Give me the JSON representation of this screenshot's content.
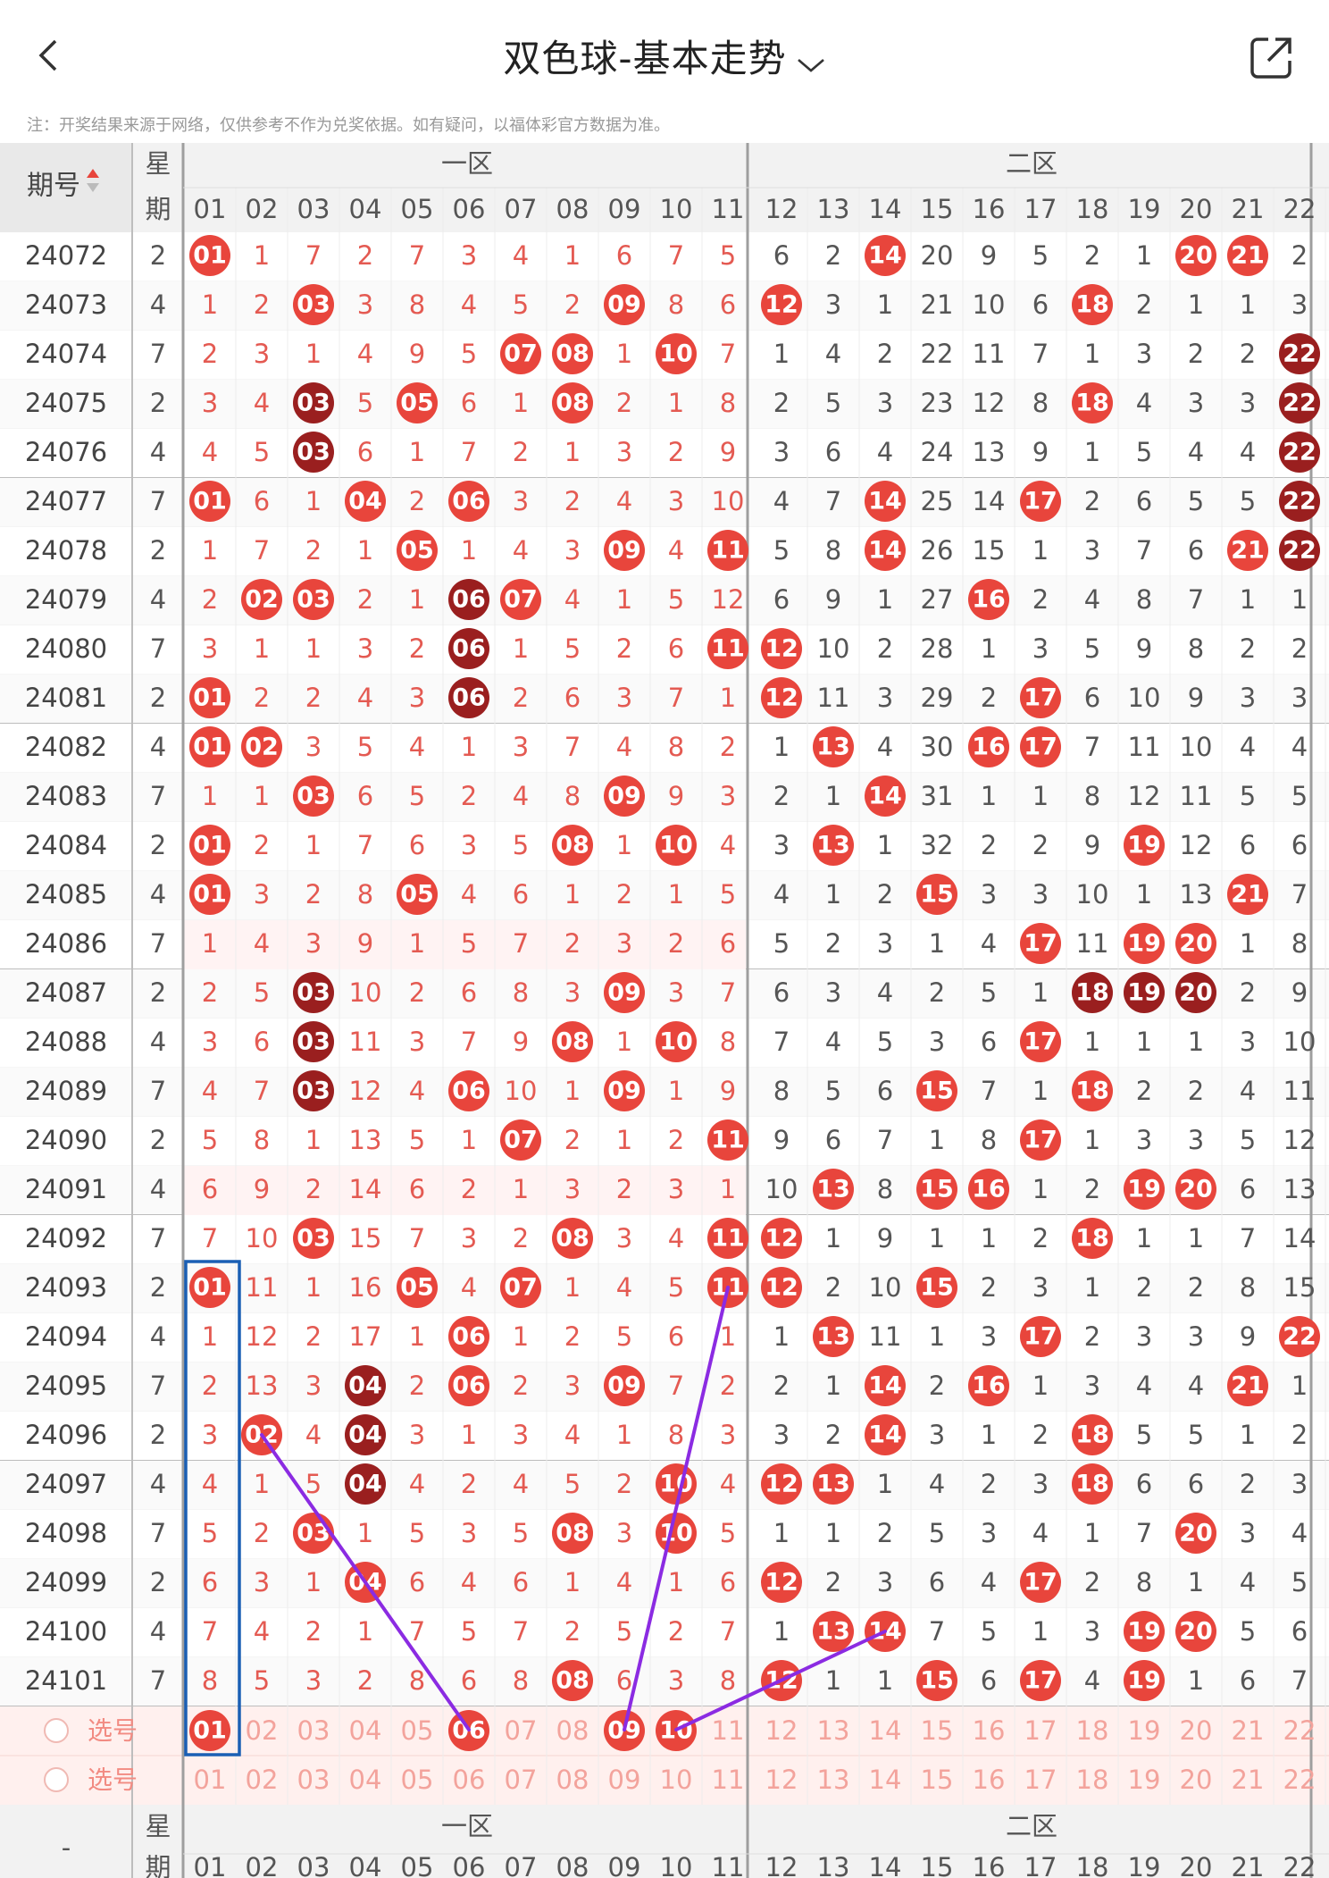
{
  "header": {
    "title": "双色球-基本走势",
    "note": "注：开奖结果来源于网络，仅供参考不作为兑奖依据。如有疑问，以福体彩官方数据为准。"
  },
  "columns": {
    "period_label": "期号",
    "week_label_1": "星",
    "week_label_2": "期",
    "zone1": "一区",
    "zone2": "二区",
    "numbers": [
      "01",
      "02",
      "03",
      "04",
      "05",
      "06",
      "07",
      "08",
      "09",
      "10",
      "11",
      "12",
      "13",
      "14",
      "15",
      "16",
      "17",
      "18",
      "19",
      "20",
      "21",
      "22"
    ]
  },
  "rows": [
    {
      "period": "24072",
      "week": "2",
      "cells": [
        "01",
        "1",
        "7",
        "2",
        "7",
        "3",
        "4",
        "1",
        "6",
        "7",
        "5",
        "6",
        "2",
        "14",
        "20",
        "9",
        "5",
        "2",
        "1",
        "20",
        "21",
        "2"
      ]
    },
    {
      "period": "24073",
      "week": "4",
      "cells": [
        "1",
        "2",
        "03",
        "3",
        "8",
        "4",
        "5",
        "2",
        "09",
        "8",
        "6",
        "12",
        "3",
        "1",
        "21",
        "10",
        "6",
        "18",
        "2",
        "1",
        "1",
        "3"
      ]
    },
    {
      "period": "24074",
      "week": "7",
      "cells": [
        "2",
        "3",
        "1",
        "4",
        "9",
        "5",
        "07",
        "08",
        "1",
        "10",
        "7",
        "1",
        "4",
        "2",
        "22",
        "11",
        "7",
        "1",
        "3",
        "2",
        "2",
        "22"
      ]
    },
    {
      "period": "24075",
      "week": "2",
      "cells": [
        "3",
        "4",
        "03",
        "5",
        "05",
        "6",
        "1",
        "08",
        "2",
        "1",
        "8",
        "2",
        "5",
        "3",
        "23",
        "12",
        "8",
        "18",
        "4",
        "3",
        "3",
        "22"
      ]
    },
    {
      "period": "24076",
      "week": "4",
      "cells": [
        "4",
        "5",
        "03",
        "6",
        "1",
        "7",
        "2",
        "1",
        "3",
        "2",
        "9",
        "3",
        "6",
        "4",
        "24",
        "13",
        "9",
        "1",
        "5",
        "4",
        "4",
        "22"
      ]
    },
    {
      "period": "24077",
      "week": "7",
      "cells": [
        "01",
        "6",
        "1",
        "04",
        "2",
        "06",
        "3",
        "2",
        "4",
        "3",
        "10",
        "4",
        "7",
        "14",
        "25",
        "14",
        "17",
        "2",
        "6",
        "5",
        "5",
        "22"
      ]
    },
    {
      "period": "24078",
      "week": "2",
      "cells": [
        "1",
        "7",
        "2",
        "1",
        "05",
        "1",
        "4",
        "3",
        "09",
        "4",
        "11",
        "5",
        "8",
        "14",
        "26",
        "15",
        "1",
        "3",
        "7",
        "6",
        "21",
        "22"
      ]
    },
    {
      "period": "24079",
      "week": "4",
      "cells": [
        "2",
        "02",
        "03",
        "2",
        "1",
        "06",
        "07",
        "4",
        "1",
        "5",
        "12",
        "6",
        "9",
        "1",
        "27",
        "16",
        "2",
        "4",
        "8",
        "7",
        "1",
        "1"
      ]
    },
    {
      "period": "24080",
      "week": "7",
      "cells": [
        "3",
        "1",
        "1",
        "3",
        "2",
        "06",
        "1",
        "5",
        "2",
        "6",
        "11",
        "12",
        "10",
        "2",
        "28",
        "1",
        "3",
        "5",
        "9",
        "8",
        "2",
        "2"
      ]
    },
    {
      "period": "24081",
      "week": "2",
      "cells": [
        "01",
        "2",
        "2",
        "4",
        "3",
        "06",
        "2",
        "6",
        "3",
        "7",
        "1",
        "12",
        "11",
        "3",
        "29",
        "2",
        "17",
        "6",
        "10",
        "9",
        "3",
        "3"
      ]
    },
    {
      "period": "24082",
      "week": "4",
      "cells": [
        "01",
        "02",
        "3",
        "5",
        "4",
        "1",
        "3",
        "7",
        "4",
        "8",
        "2",
        "1",
        "13",
        "4",
        "30",
        "16",
        "17",
        "7",
        "11",
        "10",
        "4",
        "4"
      ]
    },
    {
      "period": "24083",
      "week": "7",
      "cells": [
        "1",
        "1",
        "03",
        "6",
        "5",
        "2",
        "4",
        "8",
        "09",
        "9",
        "3",
        "2",
        "1",
        "14",
        "31",
        "1",
        "1",
        "8",
        "12",
        "11",
        "5",
        "5"
      ]
    },
    {
      "period": "24084",
      "week": "2",
      "cells": [
        "01",
        "2",
        "1",
        "7",
        "6",
        "3",
        "5",
        "08",
        "1",
        "10",
        "4",
        "3",
        "13",
        "1",
        "32",
        "2",
        "2",
        "9",
        "19",
        "12",
        "6",
        "6"
      ]
    },
    {
      "period": "24085",
      "week": "4",
      "cells": [
        "01",
        "3",
        "2",
        "8",
        "05",
        "4",
        "6",
        "1",
        "2",
        "1",
        "5",
        "4",
        "1",
        "2",
        "15",
        "3",
        "3",
        "10",
        "1",
        "13",
        "21",
        "7"
      ]
    },
    {
      "period": "24086",
      "week": "7",
      "cells": [
        "1",
        "4",
        "3",
        "9",
        "1",
        "5",
        "7",
        "2",
        "3",
        "2",
        "6",
        "5",
        "2",
        "3",
        "1",
        "4",
        "17",
        "11",
        "19",
        "20",
        "1",
        "8"
      ]
    },
    {
      "period": "24087",
      "week": "2",
      "cells": [
        "2",
        "5",
        "03",
        "10",
        "2",
        "6",
        "8",
        "3",
        "09",
        "3",
        "7",
        "6",
        "3",
        "4",
        "2",
        "5",
        "1",
        "18",
        "19",
        "20",
        "2",
        "9"
      ]
    },
    {
      "period": "24088",
      "week": "4",
      "cells": [
        "3",
        "6",
        "03",
        "11",
        "3",
        "7",
        "9",
        "08",
        "1",
        "10",
        "8",
        "7",
        "4",
        "5",
        "3",
        "6",
        "17",
        "1",
        "1",
        "1",
        "3",
        "10"
      ]
    },
    {
      "period": "24089",
      "week": "7",
      "cells": [
        "4",
        "7",
        "03",
        "12",
        "4",
        "06",
        "10",
        "1",
        "09",
        "1",
        "9",
        "8",
        "5",
        "6",
        "15",
        "7",
        "1",
        "18",
        "2",
        "2",
        "4",
        "11"
      ]
    },
    {
      "period": "24090",
      "week": "2",
      "cells": [
        "5",
        "8",
        "1",
        "13",
        "5",
        "1",
        "07",
        "2",
        "1",
        "2",
        "11",
        "9",
        "6",
        "7",
        "1",
        "8",
        "17",
        "1",
        "3",
        "3",
        "5",
        "12"
      ]
    },
    {
      "period": "24091",
      "week": "4",
      "cells": [
        "6",
        "9",
        "2",
        "14",
        "6",
        "2",
        "1",
        "3",
        "2",
        "3",
        "1",
        "10",
        "13",
        "8",
        "15",
        "16",
        "1",
        "2",
        "19",
        "20",
        "6",
        "13"
      ]
    },
    {
      "period": "24092",
      "week": "7",
      "cells": [
        "7",
        "10",
        "03",
        "15",
        "7",
        "3",
        "2",
        "08",
        "3",
        "4",
        "11",
        "12",
        "1",
        "9",
        "1",
        "1",
        "2",
        "18",
        "1",
        "1",
        "7",
        "14"
      ]
    },
    {
      "period": "24093",
      "week": "2",
      "cells": [
        "01",
        "11",
        "1",
        "16",
        "05",
        "4",
        "07",
        "1",
        "4",
        "5",
        "11",
        "12",
        "2",
        "10",
        "15",
        "2",
        "3",
        "1",
        "2",
        "2",
        "8",
        "15"
      ]
    },
    {
      "period": "24094",
      "week": "4",
      "cells": [
        "1",
        "12",
        "2",
        "17",
        "1",
        "06",
        "1",
        "2",
        "5",
        "6",
        "1",
        "1",
        "13",
        "11",
        "1",
        "3",
        "17",
        "2",
        "3",
        "3",
        "9",
        "22"
      ]
    },
    {
      "period": "24095",
      "week": "7",
      "cells": [
        "2",
        "13",
        "3",
        "04",
        "2",
        "06",
        "2",
        "3",
        "09",
        "7",
        "2",
        "2",
        "1",
        "14",
        "2",
        "16",
        "1",
        "3",
        "4",
        "4",
        "21",
        "1"
      ]
    },
    {
      "period": "24096",
      "week": "2",
      "cells": [
        "3",
        "02",
        "4",
        "04",
        "3",
        "1",
        "3",
        "4",
        "1",
        "8",
        "3",
        "3",
        "2",
        "14",
        "3",
        "1",
        "2",
        "18",
        "5",
        "5",
        "1",
        "2"
      ]
    },
    {
      "period": "24097",
      "week": "4",
      "cells": [
        "4",
        "1",
        "5",
        "04",
        "4",
        "2",
        "4",
        "5",
        "2",
        "10",
        "4",
        "12",
        "13",
        "1",
        "4",
        "2",
        "3",
        "18",
        "6",
        "6",
        "2",
        "3"
      ]
    },
    {
      "period": "24098",
      "week": "7",
      "cells": [
        "5",
        "2",
        "03",
        "1",
        "5",
        "3",
        "5",
        "08",
        "3",
        "10",
        "5",
        "1",
        "1",
        "2",
        "5",
        "3",
        "4",
        "1",
        "7",
        "20",
        "3",
        "4"
      ]
    },
    {
      "period": "24099",
      "week": "2",
      "cells": [
        "6",
        "3",
        "1",
        "04",
        "6",
        "4",
        "6",
        "1",
        "4",
        "1",
        "6",
        "12",
        "2",
        "3",
        "6",
        "4",
        "17",
        "2",
        "8",
        "1",
        "4",
        "5"
      ]
    },
    {
      "period": "24100",
      "week": "4",
      "cells": [
        "7",
        "4",
        "2",
        "1",
        "7",
        "5",
        "7",
        "2",
        "5",
        "2",
        "7",
        "1",
        "13",
        "14",
        "7",
        "5",
        "1",
        "3",
        "19",
        "20",
        "5",
        "6"
      ]
    },
    {
      "period": "24101",
      "week": "7",
      "cells": [
        "8",
        "5",
        "3",
        "2",
        "8",
        "6",
        "8",
        "08",
        "6",
        "3",
        "8",
        "12",
        "1",
        "1",
        "15",
        "6",
        "17",
        "4",
        "19",
        "1",
        "6",
        "7"
      ]
    }
  ],
  "select_rows": [
    {
      "label": "选号",
      "selected": [
        "01",
        "06",
        "09",
        "10"
      ]
    },
    {
      "label": "选号",
      "selected": []
    }
  ],
  "colors": {
    "red_ball": "#e8453c",
    "dark_ball": "#9a1f1f",
    "annotation_line": "#8b2be2",
    "annotation_box": "#1a5fb4"
  }
}
